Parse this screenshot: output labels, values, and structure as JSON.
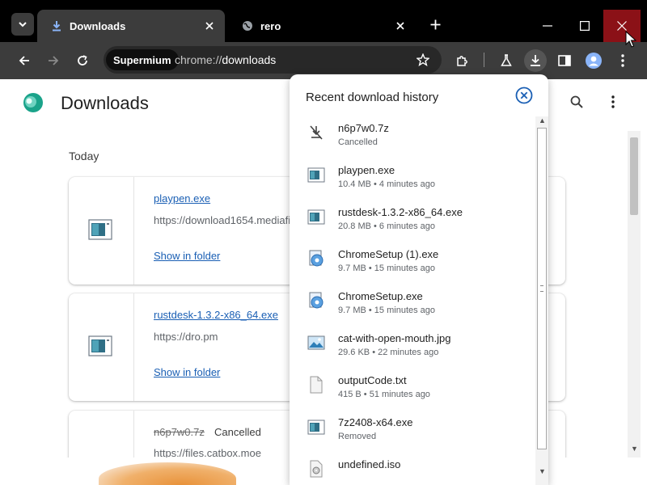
{
  "browser": {
    "tabs": [
      {
        "title": "Downloads",
        "active": true,
        "icon": "download-icon"
      },
      {
        "title": "rero",
        "active": false,
        "icon": "globe-icon"
      }
    ],
    "new_tab_label": "+",
    "address_bar": {
      "site_chip": "Supermium",
      "url_scheme": "chrome://",
      "url_path": "downloads"
    },
    "colors": {
      "titlebar": "#000000",
      "toolbar": "#3c3c3c",
      "close_button": "#8b1117",
      "link": "#1a5fb4"
    }
  },
  "page": {
    "title": "Downloads",
    "date_heading": "Today",
    "items": [
      {
        "file_name": "playpen.exe",
        "url": "https://download1654.mediafire.com",
        "action": "Show in folder",
        "status": ""
      },
      {
        "file_name": "rustdesk-1.3.2-x86_64.exe",
        "url": "https://dro.pm",
        "action": "Show in folder",
        "status": ""
      },
      {
        "file_name": "n6p7w0.7z",
        "url": "https://files.catbox.moe",
        "action": "",
        "status": "Cancelled"
      }
    ]
  },
  "download_bubble": {
    "title": "Recent download history",
    "items": [
      {
        "name": "n6p7w0.7z",
        "meta": "Cancelled",
        "icon": "cancelled-download-icon"
      },
      {
        "name": "playpen.exe",
        "meta": "10.4 MB • 4 minutes ago",
        "icon": "exe-file-icon"
      },
      {
        "name": "rustdesk-1.3.2-x86_64.exe",
        "meta": "20.8 MB • 6 minutes ago",
        "icon": "exe-file-icon"
      },
      {
        "name": "ChromeSetup (1).exe",
        "meta": "9.7 MB • 15 minutes ago",
        "icon": "installer-file-icon"
      },
      {
        "name": "ChromeSetup.exe",
        "meta": "9.7 MB • 15 minutes ago",
        "icon": "installer-file-icon"
      },
      {
        "name": "cat-with-open-mouth.jpg",
        "meta": "29.6 KB • 22 minutes ago",
        "icon": "image-file-icon"
      },
      {
        "name": "outputCode.txt",
        "meta": "415 B • 51 minutes ago",
        "icon": "text-file-icon"
      },
      {
        "name": "7z2408-x64.exe",
        "meta": "Removed",
        "icon": "exe-file-icon"
      },
      {
        "name": "undefined.iso",
        "meta": "",
        "icon": "disc-image-icon"
      }
    ]
  }
}
